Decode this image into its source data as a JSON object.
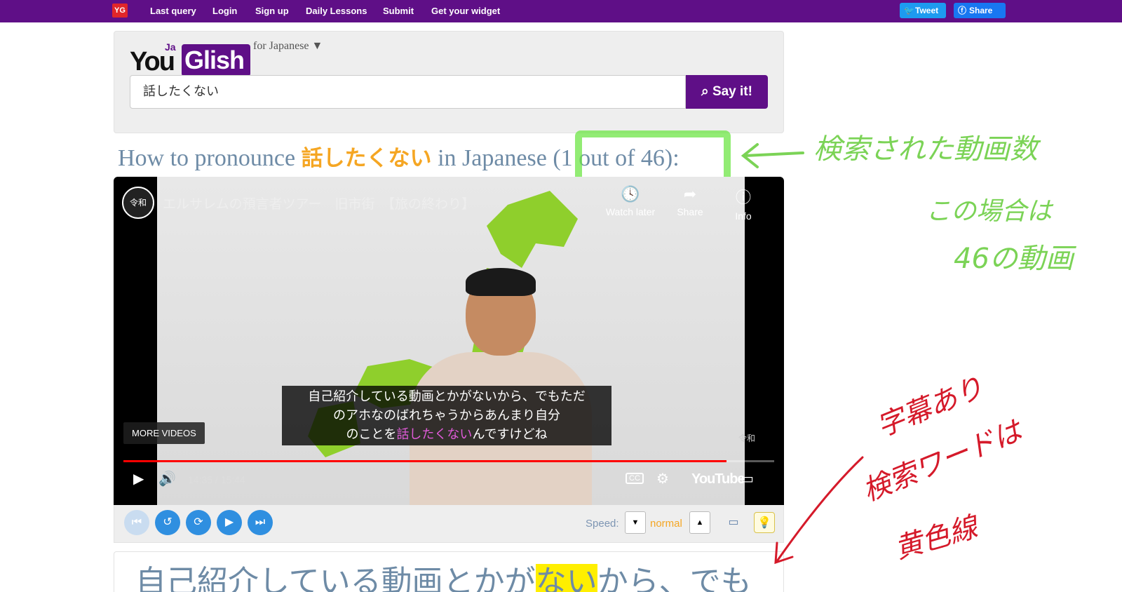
{
  "nav": {
    "badge": "YG",
    "links": [
      "Last query",
      "Login",
      "Sign up",
      "Daily Lessons",
      "Submit",
      "Get your widget"
    ],
    "tweet": "Tweet",
    "share": "Share"
  },
  "logo": {
    "you": "You",
    "ja": "Ja",
    "glish": "Glish",
    "lang": "for Japanese ▼"
  },
  "search": {
    "value": "話したくない",
    "button": "Say it!"
  },
  "heading": {
    "prefix": "How to pronounce ",
    "keyword": "話したくない",
    "suffix": " in Japanese ",
    "count": "(1 out of 46):"
  },
  "video": {
    "channel_logo": "令和",
    "title": "エルサレムの預言者ツアー　旧市街　【旅の終わり】",
    "watch_later": "Watch later",
    "share": "Share",
    "info": "Info",
    "subtitle_line1": "自己紹介している動画とかがないから、でもただ",
    "subtitle_line2": "のアホなのばれちゃうからあんまり自分",
    "subtitle_line3_pre": "のことを",
    "subtitle_line3_kw": "話したくない",
    "subtitle_line3_post": "んですけどね",
    "more_videos": "MORE VIDEOS",
    "time": "14:35 / 15:44",
    "progress": 0.927,
    "youtube": "YouTube",
    "cc": "CC",
    "watermark": "令和"
  },
  "toolbar": {
    "speed_label": "Speed:",
    "speed_value": "normal"
  },
  "caption": {
    "pre": "自己紹介している動画とかが",
    "kw": "ない",
    "post": "から、でも"
  },
  "annotations": {
    "green1": "検索された動画数",
    "green2": "この場合は",
    "green3": "46の動画",
    "red1": "字幕あり",
    "red2": "検索ワードは",
    "red3": "黄色線"
  },
  "colors": {
    "brand": "#5f0f87",
    "keyword": "#f5a623",
    "highlight": "#ffef00",
    "annotation_green": "#7bd356",
    "annotation_red": "#d51a2a"
  }
}
